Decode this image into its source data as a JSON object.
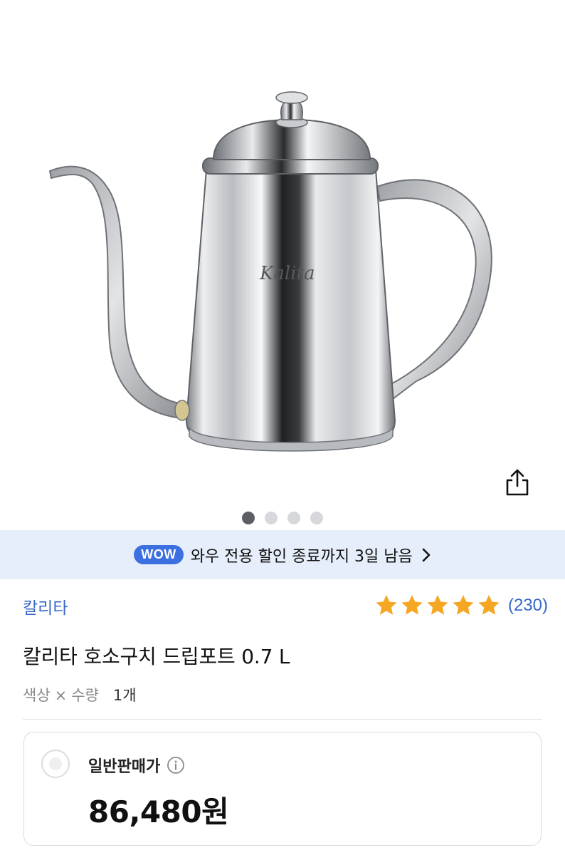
{
  "product_image": {
    "brand_mark": "Kalita",
    "icons": {
      "share": "share-icon"
    },
    "carousel": {
      "total": 4,
      "active_index": 0
    }
  },
  "wow_banner": {
    "badge": "WOW",
    "text": "와우 전용 할인 종료까지 3일 남음",
    "icon": "chevron-right-icon",
    "colors": {
      "background": "#e7eefb",
      "badge": "#3c6fe0"
    }
  },
  "product": {
    "brand": "칼리타",
    "title": "칼리타 호소구치 드립포트 0.7 L",
    "rating": {
      "stars": 5,
      "max": 5,
      "count": "(230)",
      "star_color": "#f5a623"
    },
    "options": {
      "color": "색상",
      "separator": "×",
      "quantity_label": "수량",
      "quantity_value": "1개"
    }
  },
  "price_card": {
    "label": "일반판매가",
    "info_icon": "info-icon",
    "value": "86,480원",
    "selected": false
  },
  "accent_color": "#3868c8"
}
